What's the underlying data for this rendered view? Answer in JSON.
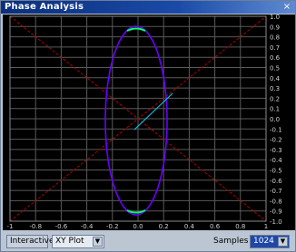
{
  "window": {
    "title": "Phase Analysis",
    "close_glyph": "×"
  },
  "plot": {
    "y_ticks": [
      "1.0",
      "0.9",
      "0.8",
      "0.7",
      "0.6",
      "0.5",
      "0.4",
      "0.3",
      "0.2",
      "0.1",
      "0.0",
      "-0.1",
      "-0.2",
      "-0.3",
      "-0.4",
      "-0.5",
      "-0.6",
      "-0.7",
      "-0.8",
      "-0.9",
      "-1.0"
    ],
    "x_ticks": [
      "-1",
      "-0.8",
      "-0.6",
      "-0.4",
      "-0.2",
      "0.0",
      "0.2",
      "0.4",
      "0.6",
      "0.8",
      "1"
    ],
    "colors": {
      "grid": "#5a5a5a",
      "diag": "#b00000",
      "trace_main": "#6a00ff",
      "trace_alt": "#00d0ff",
      "corner": "#00ff66"
    }
  },
  "controls": {
    "left_button": "Interactive",
    "mode_value": "XY Plot",
    "samples_label": "Samples",
    "samples_value": "1024"
  }
}
